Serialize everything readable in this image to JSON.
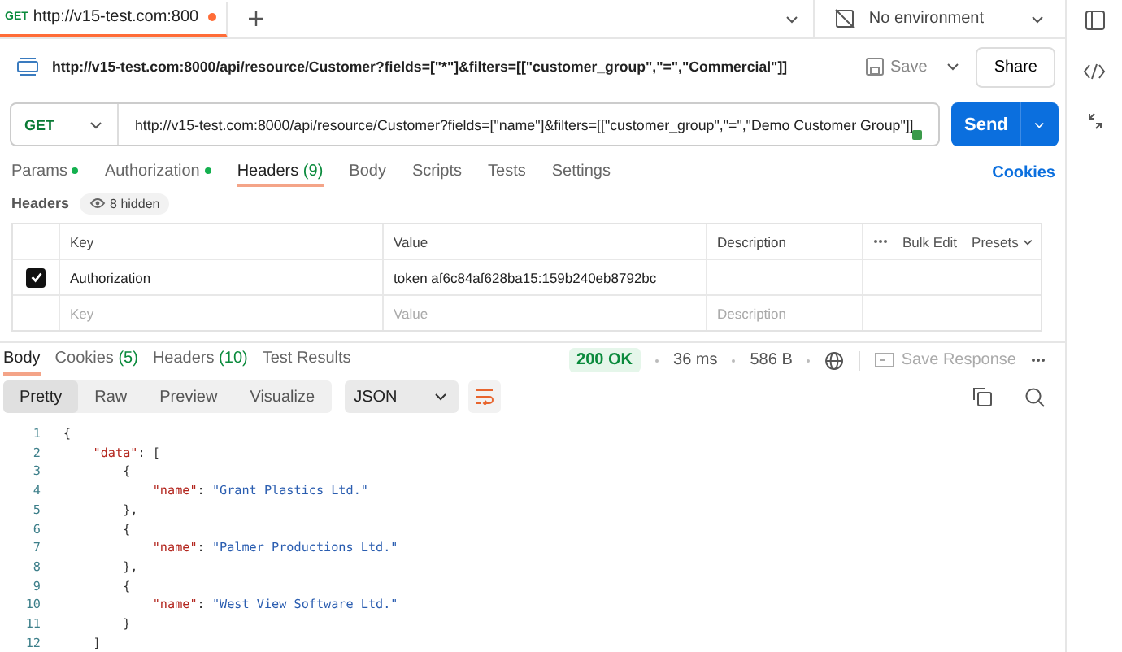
{
  "tab_bar": {
    "tabs": [
      {
        "method": "GET",
        "title": "http://v15-test.com:800",
        "unsaved": true,
        "selected": true
      }
    ],
    "environment": "No environment"
  },
  "request": {
    "title": "http://v15-test.com:8000/api/resource/Customer?fields=[\"*\"]&filters=[[\"customer_group\",\"=\",\"Commercial\"]]",
    "save": "Save",
    "share": "Share"
  },
  "url_bar": {
    "method": "GET",
    "url": "http://v15-test.com:8000/api/resource/Customer?fields=[\"name\"]&filters=[[\"customer_group\",\"=\",\"Demo Customer Group\"]]",
    "send": "Send"
  },
  "request_tabs": [
    {
      "label": "Params",
      "dot": true,
      "selected": false
    },
    {
      "label": "Authorization",
      "dot": true,
      "selected": false
    },
    {
      "label": "Headers",
      "count": "(9)",
      "dot": false,
      "selected": true
    },
    {
      "label": "Body",
      "dot": false,
      "selected": false
    },
    {
      "label": "Scripts",
      "dot": false,
      "selected": false
    },
    {
      "label": "Tests",
      "dot": false,
      "selected": false
    },
    {
      "label": "Settings",
      "dot": false,
      "selected": false
    }
  ],
  "cookies_link": "Cookies",
  "headers": {
    "label": "Headers",
    "hidden": "8 hidden",
    "columns": [
      "Key",
      "Value",
      "Description"
    ],
    "bulk_edit": "Bulk Edit",
    "presets": "Presets",
    "rows": [
      {
        "checked": true,
        "key": "Authorization",
        "value": "token af6c84af628ba15:159b240eb8792bc"
      }
    ],
    "new_row": {
      "key": "Key",
      "value": "Value",
      "description": "Description"
    }
  },
  "response": {
    "tabs": [
      {
        "label": "Body",
        "selected": true
      },
      {
        "label": "Cookies",
        "count": "(5)",
        "selected": false
      },
      {
        "label": "Headers",
        "count": "(10)",
        "selected": false
      },
      {
        "label": "Test Results",
        "selected": false
      }
    ],
    "status": "200 OK",
    "time": "36 ms",
    "size": "586 B",
    "save_response": "Save Response",
    "view_modes": [
      {
        "label": "Pretty",
        "selected": true
      },
      {
        "label": "Raw",
        "selected": false
      },
      {
        "label": "Preview",
        "selected": false
      },
      {
        "label": "Visualize",
        "selected": false
      }
    ],
    "format": "JSON",
    "code": [
      {
        "number": "1",
        "tokens": [
          {
            "kind": "punct",
            "text": "{"
          }
        ]
      },
      {
        "number": "2",
        "tokens": [
          {
            "kind": "key",
            "text": "    \"data\""
          },
          {
            "kind": "punct",
            "text": ": ["
          }
        ]
      },
      {
        "number": "3",
        "tokens": [
          {
            "kind": "punct",
            "text": "        {"
          }
        ]
      },
      {
        "number": "4",
        "tokens": [
          {
            "kind": "key",
            "text": "            \"name\""
          },
          {
            "kind": "punct",
            "text": ": "
          },
          {
            "kind": "string",
            "text": "\"Grant Plastics Ltd.\""
          }
        ]
      },
      {
        "number": "5",
        "tokens": [
          {
            "kind": "punct",
            "text": "        },"
          }
        ]
      },
      {
        "number": "6",
        "tokens": [
          {
            "kind": "punct",
            "text": "        {"
          }
        ]
      },
      {
        "number": "7",
        "tokens": [
          {
            "kind": "key",
            "text": "            \"name\""
          },
          {
            "kind": "punct",
            "text": ": "
          },
          {
            "kind": "string",
            "text": "\"Palmer Productions Ltd.\""
          }
        ]
      },
      {
        "number": "8",
        "tokens": [
          {
            "kind": "punct",
            "text": "        },"
          }
        ]
      },
      {
        "number": "9",
        "tokens": [
          {
            "kind": "punct",
            "text": "        {"
          }
        ]
      },
      {
        "number": "10",
        "tokens": [
          {
            "kind": "key",
            "text": "            \"name\""
          },
          {
            "kind": "punct",
            "text": ": "
          },
          {
            "kind": "string",
            "text": "\"West View Software Ltd.\""
          }
        ]
      },
      {
        "number": "11",
        "tokens": [
          {
            "kind": "punct",
            "text": "        }"
          }
        ]
      },
      {
        "number": "12",
        "tokens": [
          {
            "kind": "punct",
            "text": "    ]"
          }
        ]
      }
    ]
  }
}
